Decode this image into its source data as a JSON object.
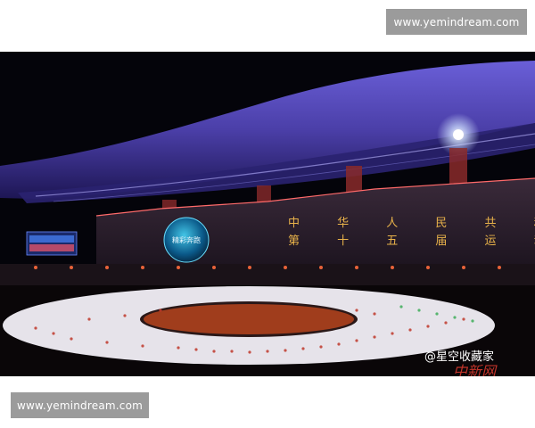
{
  "watermark": {
    "top_text": "www.yemindream.com",
    "bottom_text": "www.yemindream.com"
  },
  "scene": {
    "banner_line1": "中 华 人 民 共 和 国",
    "banner_line2": "第 十 五 届 运 动 会",
    "globe_text": "精彩奔跑",
    "credit_text": "@星空收藏家",
    "credit_partial": "中新网"
  },
  "colors": {
    "roof": "#4b3fa8",
    "night_sky": "#04040a",
    "banner_text": "#e8b24a",
    "watermark_bg": "#9b9b9b"
  }
}
